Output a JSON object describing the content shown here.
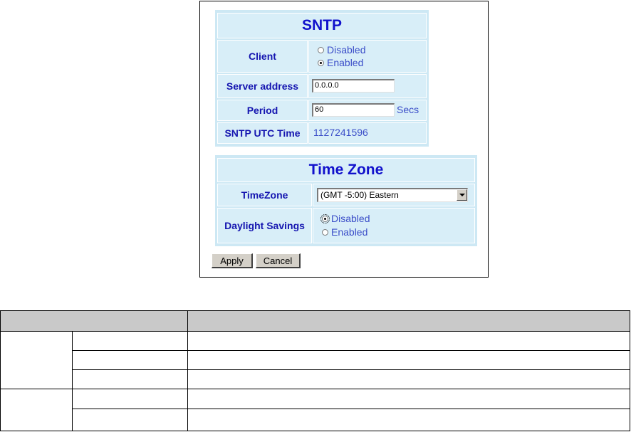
{
  "sntp": {
    "title": "SNTP",
    "client_label": "Client",
    "client_options": [
      "Disabled",
      "Enabled"
    ],
    "client_selected": "Enabled",
    "server_label": "Server address",
    "server_value": "0.0.0.0",
    "period_label": "Period",
    "period_value": "60",
    "period_unit": "Secs",
    "utc_label": "SNTP UTC Time",
    "utc_value": "1127241596"
  },
  "timezone": {
    "title": "Time Zone",
    "tz_label": "TimeZone",
    "tz_selected": "(GMT -5:00) Eastern",
    "dst_label": "Daylight Savings",
    "dst_options": [
      "Disabled",
      "Enabled"
    ],
    "dst_selected": "Disabled"
  },
  "actions": {
    "apply": "Apply",
    "cancel": "Cancel"
  },
  "colors": {
    "panel": "#cde8f4",
    "label": "#1515b0",
    "title": "#1111cc",
    "value": "#3a4dc8",
    "table_header": "#c9c9c9"
  }
}
